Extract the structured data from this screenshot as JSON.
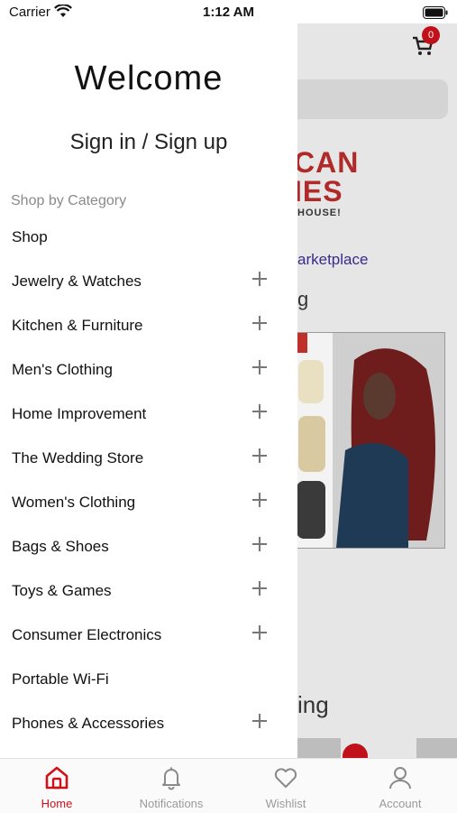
{
  "status_bar": {
    "carrier": "Carrier",
    "time": "1:12 AM"
  },
  "background": {
    "cart_count": "0",
    "logo_line1": "CAN",
    "logo_line2": "IES",
    "logo_line3": "HOUSE!",
    "marketplace_link": "arketplace",
    "section_title_1": "g",
    "section_title_2": "ing"
  },
  "drawer": {
    "welcome": "Welcome",
    "signin": "Sign in / Sign up",
    "category_heading": "Shop by Category",
    "items": [
      {
        "label": "Shop",
        "expandable": false
      },
      {
        "label": "Jewelry & Watches",
        "expandable": true
      },
      {
        "label": "Kitchen & Furniture",
        "expandable": true
      },
      {
        "label": "Men's Clothing",
        "expandable": true
      },
      {
        "label": "Home Improvement",
        "expandable": true
      },
      {
        "label": "The Wedding Store",
        "expandable": true
      },
      {
        "label": "Women's Clothing",
        "expandable": true
      },
      {
        "label": "Bags & Shoes",
        "expandable": true
      },
      {
        "label": "Toys & Games",
        "expandable": true
      },
      {
        "label": "Consumer Electronics",
        "expandable": true
      },
      {
        "label": "Portable Wi-Fi",
        "expandable": false
      },
      {
        "label": "Phones & Accessories",
        "expandable": true
      }
    ]
  },
  "tabbar": {
    "tabs": [
      {
        "label": "Home",
        "icon": "home-icon",
        "active": true
      },
      {
        "label": "Notifications",
        "icon": "bell-icon",
        "active": false
      },
      {
        "label": "Wishlist",
        "icon": "heart-icon",
        "active": false
      },
      {
        "label": "Account",
        "icon": "person-icon",
        "active": false
      }
    ]
  },
  "colors": {
    "accent": "#d01018",
    "muted": "#9a9a9a",
    "overlay": "#e6e6e6"
  }
}
